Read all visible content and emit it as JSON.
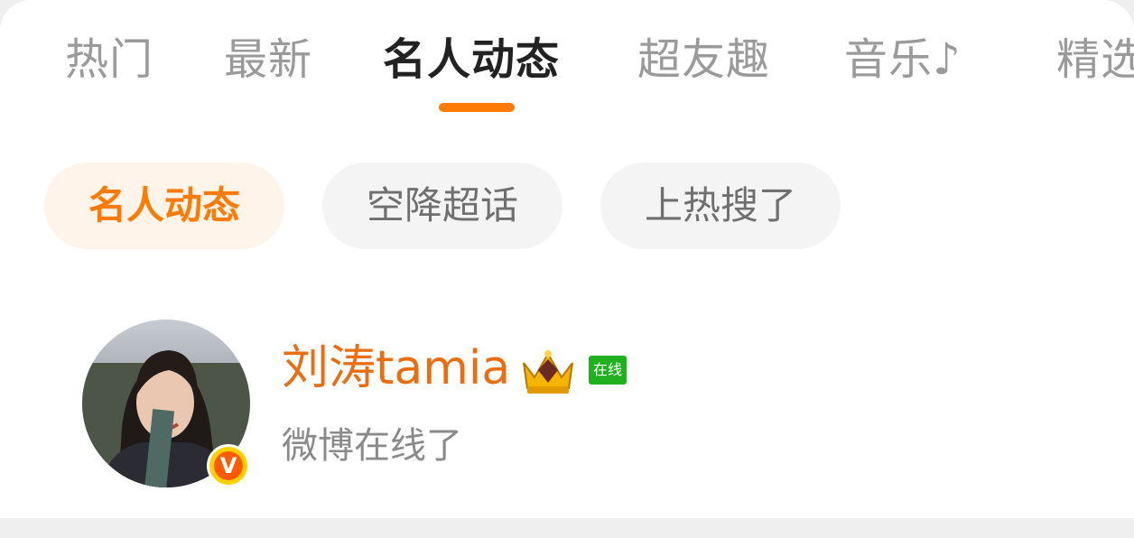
{
  "tabs": [
    {
      "label": "热门"
    },
    {
      "label": "最新"
    },
    {
      "label": "名人动态"
    },
    {
      "label": "超友趣"
    },
    {
      "label": "音乐♪"
    },
    {
      "label": "精选"
    }
  ],
  "active_tab": "名人动态",
  "chips": [
    {
      "label": "名人动态"
    },
    {
      "label": "空降超话"
    },
    {
      "label": "上热搜了"
    }
  ],
  "post": {
    "username": "刘涛tamia",
    "online_tag": "在线",
    "status_text": "微博在线了",
    "verified_badge": "V"
  },
  "colors": {
    "accent": "#ff7a00",
    "username": "#ea6d11",
    "online_tag": "#1fb11f"
  },
  "icons": {
    "crown": "crown-icon",
    "verified": "verified-v-icon"
  }
}
